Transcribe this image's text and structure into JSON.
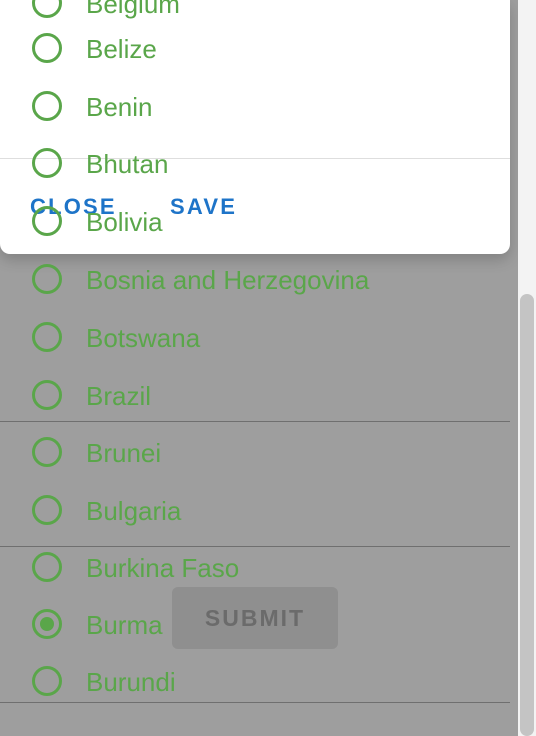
{
  "colors": {
    "accent_green": "#5aa64a",
    "dialog_button_blue": "#1e74c8",
    "scrim_gray": "#9e9e9e"
  },
  "dialog": {
    "close_label": "CLOSE",
    "save_label": "SAVE"
  },
  "page": {
    "submit_label": "SUBMIT"
  },
  "countries": [
    {
      "label": "Belgium",
      "selected": false
    },
    {
      "label": "Belize",
      "selected": false
    },
    {
      "label": "Benin",
      "selected": false
    },
    {
      "label": "Bhutan",
      "selected": false
    },
    {
      "label": "Bolivia",
      "selected": false
    },
    {
      "label": "Bosnia and Herzegovina",
      "selected": false
    },
    {
      "label": "Botswana",
      "selected": false
    },
    {
      "label": "Brazil",
      "selected": false
    },
    {
      "label": "Brunei",
      "selected": false
    },
    {
      "label": "Bulgaria",
      "selected": false
    },
    {
      "label": "Burkina Faso",
      "selected": false
    },
    {
      "label": "Burma",
      "selected": true
    },
    {
      "label": "Burundi",
      "selected": false
    }
  ]
}
